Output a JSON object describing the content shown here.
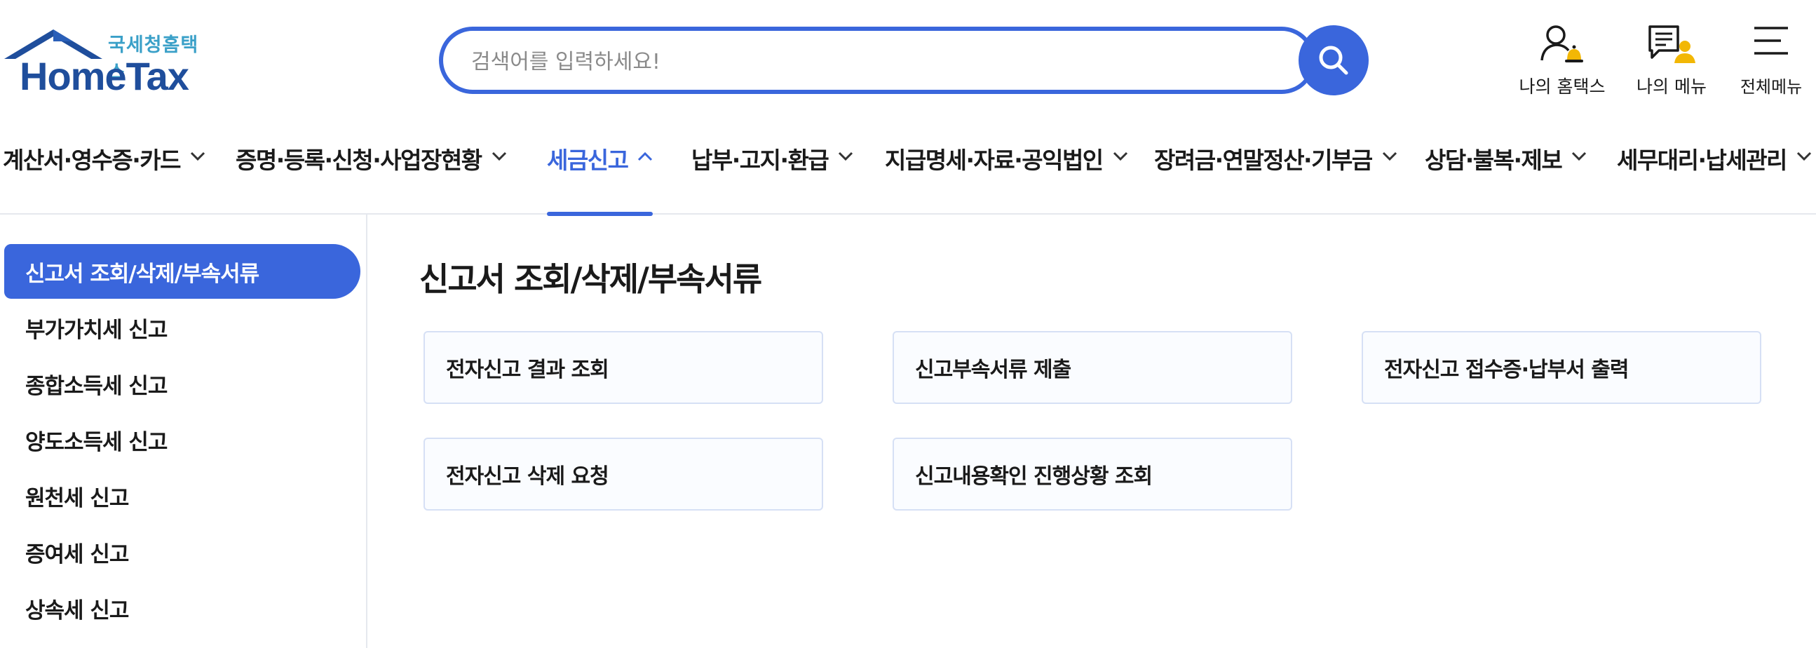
{
  "logo": {
    "sub": "국세청홈택스",
    "main": "HomeTax"
  },
  "search": {
    "placeholder": "검색어를 입력하세요!",
    "value": ""
  },
  "util": [
    {
      "label": "나의 홈택스",
      "icon": "user-bell-icon"
    },
    {
      "label": "나의 메뉴",
      "icon": "document-user-icon"
    },
    {
      "label": "전체메뉴",
      "icon": "hamburger-menu-icon"
    }
  ],
  "gnb": [
    {
      "label": "계산서·영수증·카드",
      "active": false
    },
    {
      "label": "증명·등록·신청·사업장현황",
      "active": false
    },
    {
      "label": "세금신고",
      "active": true
    },
    {
      "label": "납부·고지·환급",
      "active": false
    },
    {
      "label": "지급명세·자료·공익법인",
      "active": false
    },
    {
      "label": "장려금·연말정산·기부금",
      "active": false
    },
    {
      "label": "상담·불복·제보",
      "active": false
    },
    {
      "label": "세무대리·납세관리",
      "active": false
    }
  ],
  "sidebar": {
    "items": [
      {
        "label": "신고서 조회/삭제/부속서류",
        "active": true
      },
      {
        "label": "부가가치세 신고",
        "active": false
      },
      {
        "label": "종합소득세 신고",
        "active": false
      },
      {
        "label": "양도소득세 신고",
        "active": false
      },
      {
        "label": "원천세 신고",
        "active": false
      },
      {
        "label": "증여세 신고",
        "active": false
      },
      {
        "label": "상속세 신고",
        "active": false
      }
    ]
  },
  "content": {
    "title": "신고서 조회/삭제/부속서류",
    "cards": [
      "전자신고 결과 조회",
      "신고부속서류 제출",
      "전자신고 접수증·납부서 출력",
      "전자신고 삭제 요청",
      "신고내용확인 진행상황 조회"
    ]
  },
  "colors": {
    "accent": "#3a66dc",
    "logo_blue": "#1f4e9c",
    "logo_sub": "#3aa0c8",
    "bell": "#f2b705"
  }
}
